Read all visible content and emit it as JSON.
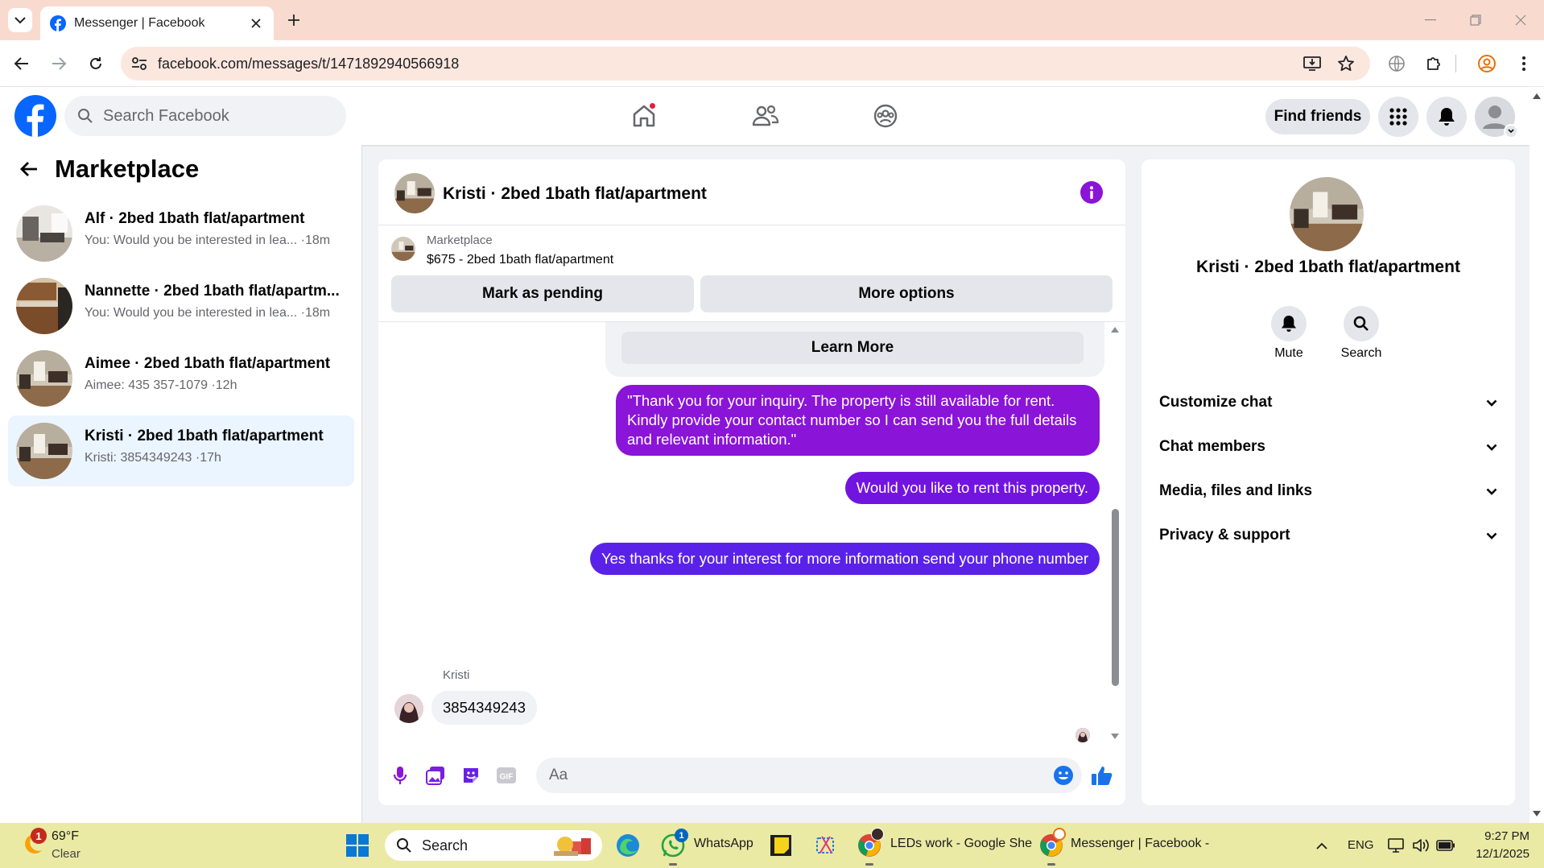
{
  "browser": {
    "tab_title": "Messenger | Facebook",
    "url": "facebook.com/messages/t/1471892940566918"
  },
  "facebook": {
    "search_placeholder": "Search Facebook",
    "find_friends": "Find friends"
  },
  "sidebar": {
    "title": "Marketplace",
    "conversations": [
      {
        "name": "Alf · 2bed 1bath flat/apartment",
        "snippet": "You: Would you be interested in lea... ·18m",
        "active": false
      },
      {
        "name": "Nannette · 2bed 1bath flat/apartm...",
        "snippet": "You: Would you be interested in lea... ·18m",
        "active": false
      },
      {
        "name": "Aimee · 2bed 1bath flat/apartment",
        "snippet": "Aimee: 435 357-1079 ·12h",
        "active": false
      },
      {
        "name": "Kristi · 2bed 1bath flat/apartment",
        "snippet": "Kristi: 3854349243 ·17h",
        "active": true
      }
    ]
  },
  "chat": {
    "title": "Kristi · 2bed 1bath flat/apartment",
    "listing": {
      "category": "Marketplace",
      "price_title": "$675 - 2bed 1bath flat/apartment",
      "mark_pending": "Mark as pending",
      "more_options": "More options"
    },
    "learn_more": "Learn More",
    "messages": {
      "out_1": "\"Thank you for your inquiry. The property is still available for rent. Kindly provide your contact number so I can send you the full details and relevant information.\"",
      "out_2": "Would you like to rent this property.",
      "out_3": "Yes thanks for your interest for more information send your phone number",
      "in_sender": "Kristi",
      "in_1": "3854349243"
    },
    "composer_placeholder": "Aa",
    "accent": "#8a14d8"
  },
  "details": {
    "name": "Kristi · 2bed 1bath flat/apartment",
    "mute": "Mute",
    "search": "Search",
    "sections": [
      "Customize chat",
      "Chat members",
      "Media, files and links",
      "Privacy & support"
    ]
  },
  "taskbar": {
    "weather_temp": "69°F",
    "weather_cond": "Clear",
    "weather_badge": "1",
    "search": "Search",
    "whatsapp": "WhatsApp",
    "whatsapp_badge": "1",
    "chrome_app_1": "LEDs work - Google She",
    "chrome_app_2": "Messenger | Facebook -",
    "lang": "ENG",
    "time": "9:27 PM",
    "date": "12/1/2025"
  }
}
